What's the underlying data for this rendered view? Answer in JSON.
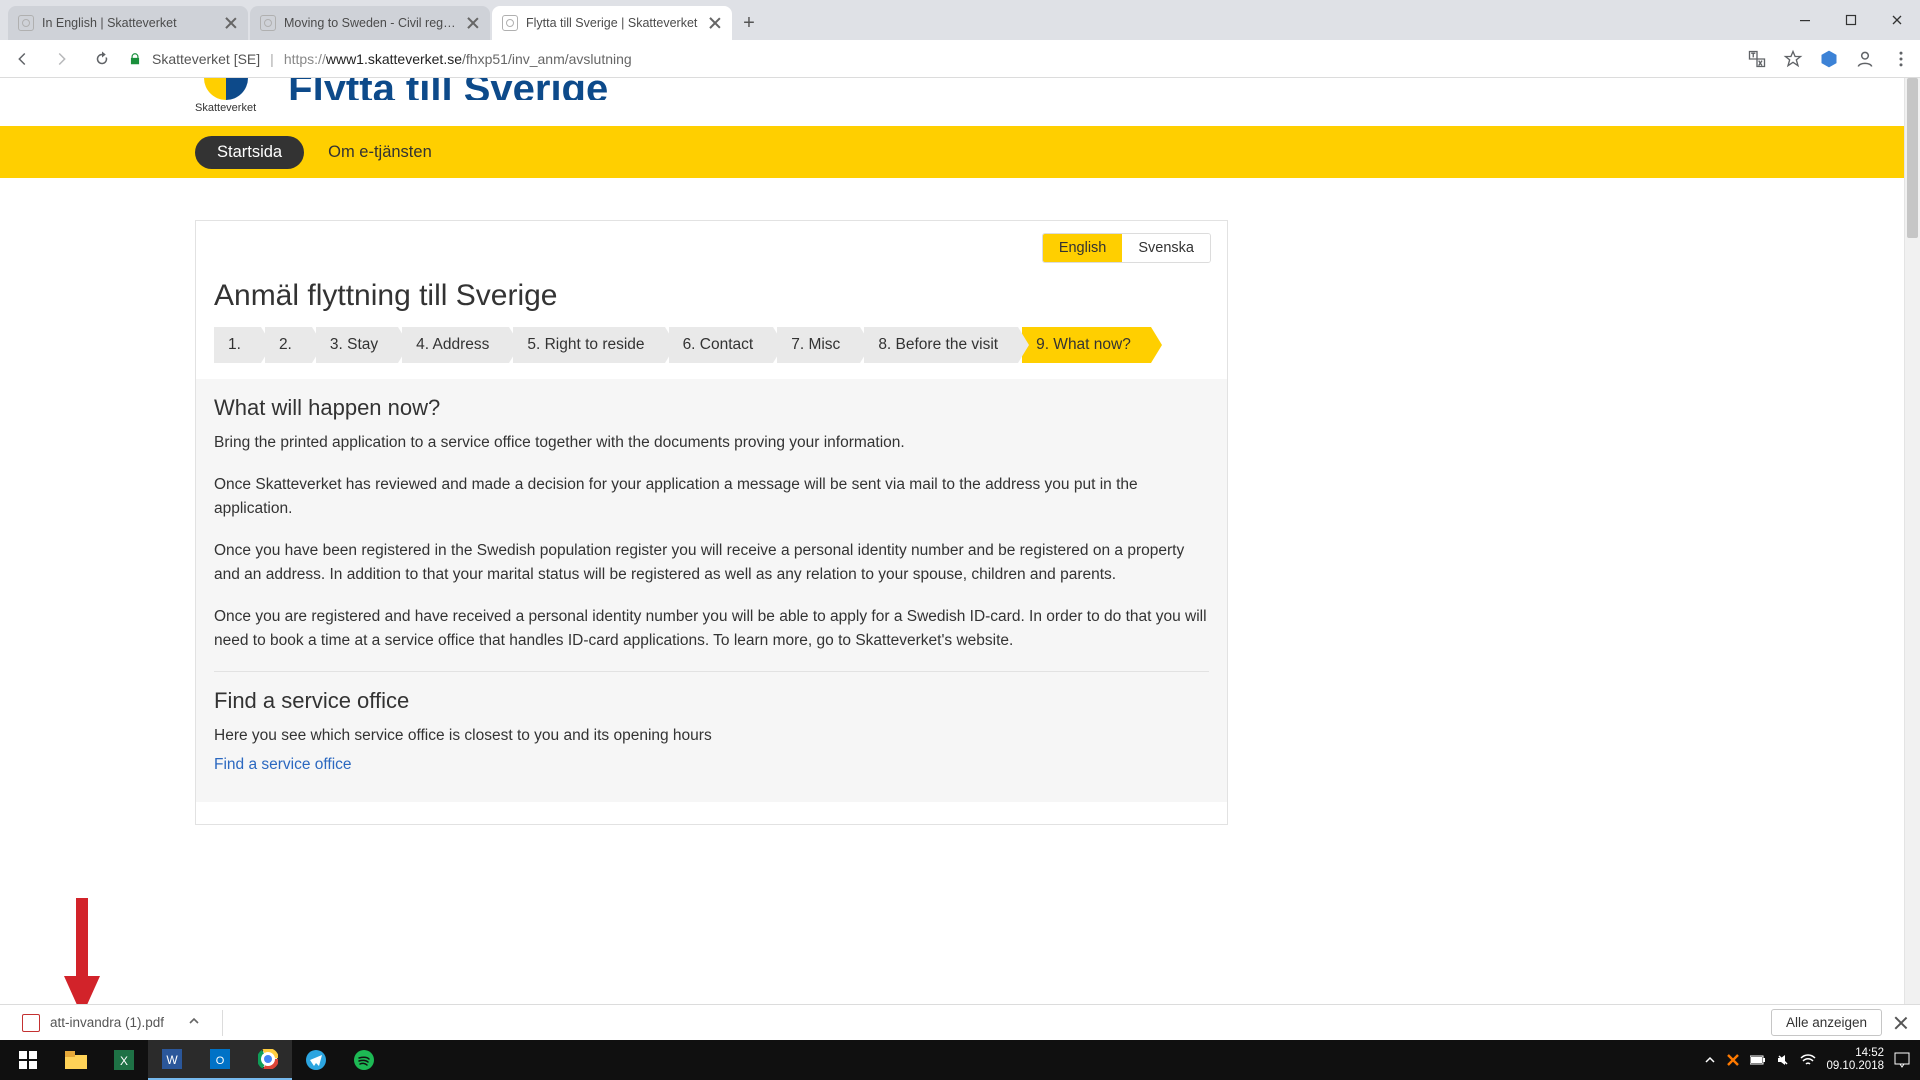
{
  "tabs": [
    {
      "title": "In English | Skatteverket"
    },
    {
      "title": "Moving to Sweden - Civil registr"
    },
    {
      "title": "Flytta till Sverige | Skatteverket"
    }
  ],
  "address": {
    "cert_label": "Skatteverket [SE]",
    "url_visible": "https://www1.skatteverket.se/fhxp51/inv_anm/avslutning",
    "host": "www1.skatteverket.se",
    "path": "/fhxp51/inv_anm/avslutning"
  },
  "toolbar_icons": {
    "translate": "translate-icon",
    "star": "bookmark-star-icon",
    "extension": "extension-icon",
    "account": "account-icon",
    "menu": "kebab-menu-icon"
  },
  "site": {
    "logo_text": "Skatteverket",
    "page_title_header": "Flytta till Sverige",
    "nav": {
      "startsida": "Startsida",
      "om": "Om e-tjänsten"
    },
    "lang": {
      "english": "English",
      "svenska": "Svenska"
    },
    "main_heading": "Anmäl flyttning till Sverige",
    "steps": [
      "1.",
      "2.",
      "3.  Stay",
      "4.  Address",
      "5.  Right to reside",
      "6.  Contact",
      "7.  Misc",
      "8.  Before the visit",
      "9.  What now?"
    ],
    "sub_heading": "What will happen now?",
    "paragraphs": [
      "Bring the printed application to a service office together with the documents proving your information.",
      "Once Skatteverket has reviewed and made a decision for your application a message will be sent via mail to the address you put in the application.",
      "Once you have been registered in the Swedish population register you will receive a personal identity number and be registered on a property and an address. In addition to that your marital status will be registered as well as any relation to your spouse, children and parents.",
      "Once you are registered and have received a personal identity number you will be able to apply for a Swedish ID-card. In order to do that you will need to book a time at a service office that handles ID-card applications. To learn more, go to Skatteverket's website."
    ],
    "find_heading": "Find a service office",
    "find_text": "Here you see which service office is closest to you and its opening hours",
    "find_link": "Find a service office"
  },
  "download": {
    "file": "att-invandra (1).pdf",
    "show_all": "Alle anzeigen"
  },
  "tray": {
    "time": "14:52",
    "date": "09.10.2018"
  }
}
